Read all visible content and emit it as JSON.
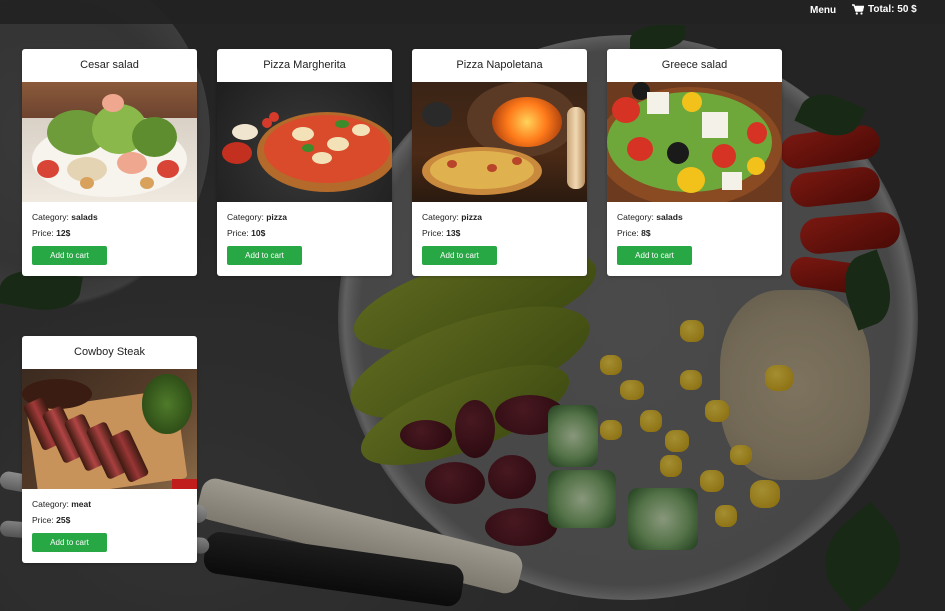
{
  "topbar": {
    "menu_label": "Menu",
    "cart_total": "Total: 50 $"
  },
  "products": [
    {
      "name": "Cesar salad",
      "category_label": "Category:",
      "category": "salads",
      "price_label": "Price:",
      "price": "12$",
      "button": "Add to cart",
      "image": "cesar-salad-photo"
    },
    {
      "name": "Pizza Margherita",
      "category_label": "Category:",
      "category": "pizza",
      "price_label": "Price:",
      "price": "10$",
      "button": "Add to cart",
      "image": "pizza-margherita-photo"
    },
    {
      "name": "Pizza Napoletana",
      "category_label": "Category:",
      "category": "pizza",
      "price_label": "Price:",
      "price": "13$",
      "button": "Add to cart",
      "image": "pizza-napoletana-photo"
    },
    {
      "name": "Greece salad",
      "category_label": "Category:",
      "category": "salads",
      "price_label": "Price:",
      "price": "8$",
      "button": "Add to cart",
      "image": "greece-salad-photo"
    },
    {
      "name": "Cowboy Steak",
      "category_label": "Category:",
      "category": "meat",
      "price_label": "Price:",
      "price": "25$",
      "button": "Add to cart",
      "image": "cowboy-steak-photo"
    }
  ],
  "colors": {
    "accent_button": "#28a745",
    "topbar_bg": "#222222",
    "card_bg": "#ffffff"
  },
  "icons": {
    "cart": "shopping-cart-icon"
  }
}
